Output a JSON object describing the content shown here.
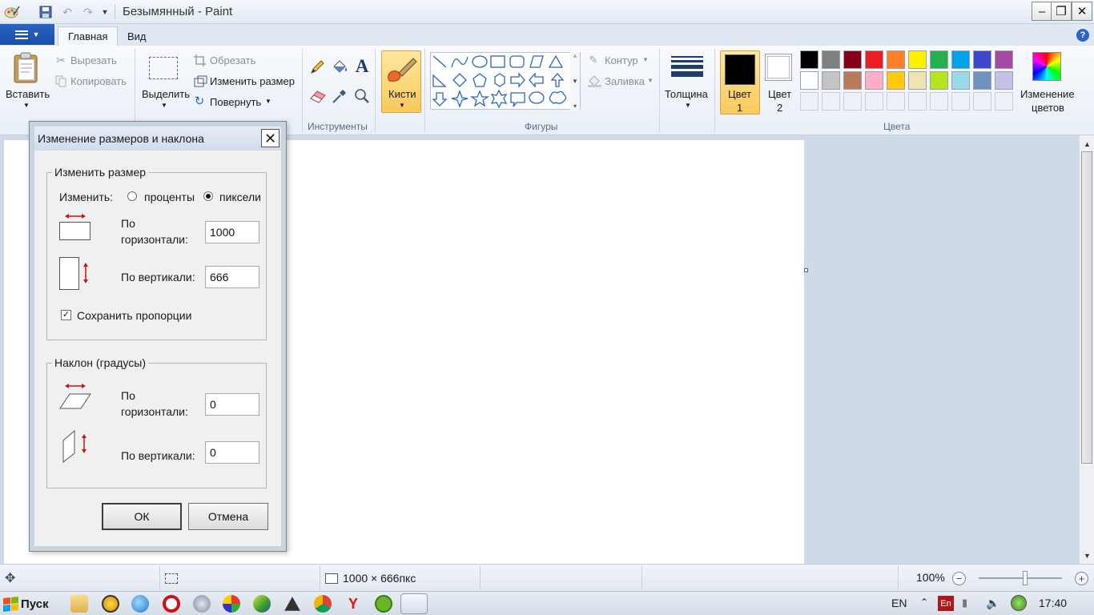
{
  "window": {
    "title": "Безымянный - Paint",
    "minimize_glyph": "–",
    "maximize_glyph": "❐",
    "close_glyph": "✕"
  },
  "ribbon_tabs": {
    "home": "Главная",
    "view": "Вид"
  },
  "clipboard": {
    "paste": "Вставить",
    "cut": "Вырезать",
    "copy": "Копировать"
  },
  "image": {
    "select": "Выделить",
    "crop": "Обрезать",
    "resize": "Изменить размер",
    "rotate": "Повернуть"
  },
  "tools": {
    "group_label": "Инструменты"
  },
  "brushes": {
    "label": "Кисти"
  },
  "shapes": {
    "group_label": "Фигуры",
    "outline": "Контур",
    "fill": "Заливка"
  },
  "size": {
    "label": "Толщина"
  },
  "colors": {
    "color1_label": "Цвет",
    "color1_num": "1",
    "color2_label": "Цвет",
    "color2_num": "2",
    "group_label": "Цвета",
    "edit_colors_line1": "Изменение",
    "edit_colors_line2": "цветов",
    "color1": "#000000",
    "color2": "#ffffff",
    "palette_row1": [
      "#000000",
      "#7f7f7f",
      "#880015",
      "#ed1c24",
      "#ff7f27",
      "#fff200",
      "#22b14c",
      "#00a2e8",
      "#3f48cc",
      "#a349a4"
    ],
    "palette_row2": [
      "#ffffff",
      "#c3c3c3",
      "#b97a57",
      "#ffaec9",
      "#ffc90e",
      "#efe4b0",
      "#b5e61d",
      "#99d9ea",
      "#7092be",
      "#c8bfe7"
    ]
  },
  "dialog": {
    "title": "Изменение размеров и наклона",
    "close_glyph": "✕",
    "resize_group": "Изменить размер",
    "by_label": "Изменить:",
    "percent_option": "проценты",
    "pixels_option": "пиксели",
    "horizontal_label_line1": "По",
    "horizontal_label_line2": "горизонтали:",
    "horizontal_value": "1000",
    "vertical_label": "По вертикали:",
    "vertical_value": "666",
    "keep_ratio": "Сохранить пропорции",
    "skew_group": "Наклон (градусы)",
    "skew_horizontal_line1": "По",
    "skew_horizontal_line2": "горизонтали:",
    "skew_horizontal_value": "0",
    "skew_vertical_label": "По вертикали:",
    "skew_vertical_value": "0",
    "ok": "ОК",
    "cancel": "Отмена"
  },
  "statusbar": {
    "image_size": "1000 × 666пкс",
    "zoom": "100%"
  },
  "taskbar": {
    "start": "Пуск",
    "lang": "EN",
    "time": "17:40",
    "en_badge": "En"
  }
}
